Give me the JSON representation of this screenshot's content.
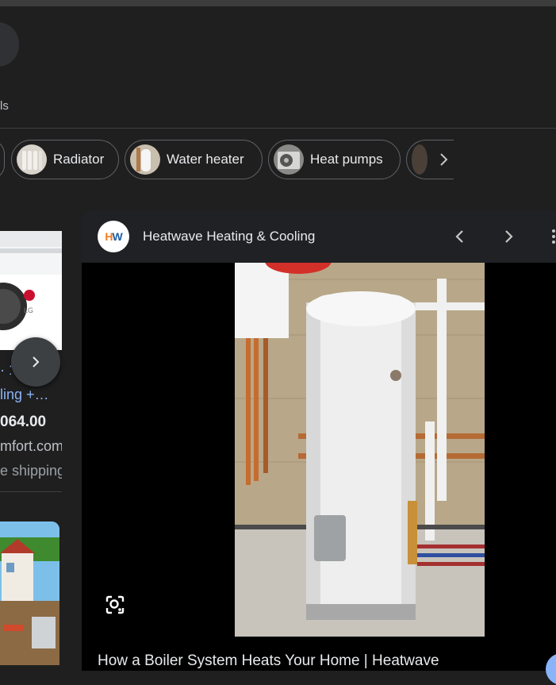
{
  "tab_fragment": "ls",
  "chips": [
    {
      "label": "Radiator",
      "icon": "radiator-thumbnail"
    },
    {
      "label": "Water heater",
      "icon": "water-heater-thumbnail"
    },
    {
      "label": "Heat pumps",
      "icon": "heat-pump-thumbnail"
    }
  ],
  "left_result": {
    "line1": "· 1",
    "line2": "ling +…",
    "price": "064.00",
    "domain": "mfort.com",
    "shipping": "e shipping"
  },
  "panel": {
    "site_name": "Heatwave Heating & Cooling",
    "logo_text": "HW",
    "title": "How a Boiler System Heats Your Home | Heatwave"
  },
  "colors": {
    "background": "#1f1f1f",
    "link": "#8ab4f8",
    "logo_orange": "#f47b20",
    "logo_blue": "#1c5fa8"
  }
}
